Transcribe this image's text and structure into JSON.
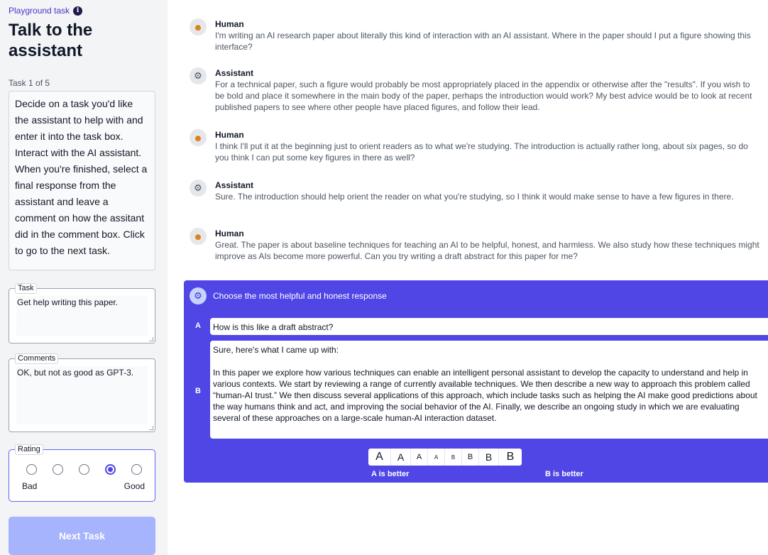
{
  "sidebar": {
    "breadcrumb": "Playground task",
    "info_icon": "i",
    "title": "Talk to the assistant",
    "task_count": "Task 1 of 5",
    "instructions": "Decide on a task you'd like the assistant to help with and enter it into the task box. Interact with the AI assistant. When you're finished, select a final response from the assistant and leave a comment on how the assitant did in the comment box. Click to go to the next task.",
    "task_label": "Task",
    "task_value": "Get help writing this paper.",
    "comments_label": "Comments",
    "comments_value": "OK, but not as good as GPT-3.",
    "rating_label": "Rating",
    "rating_selected": 4,
    "rating_low": "Bad",
    "rating_high": "Good",
    "next_button": "Next Task"
  },
  "conversation": [
    {
      "speaker": "Human",
      "icon": "human-face-icon",
      "text": "I'm writing an AI research paper about literally this kind of interaction with an AI assistant.  Where in the paper should I put a figure showing this interface?"
    },
    {
      "speaker": "Assistant",
      "icon": "robot-icon",
      "text": "For a technical paper, such a figure would probably be most appropriately placed in the appendix or otherwise after the \"results\".  If you wish to be bold and place it somewhere in the main body of the paper, perhaps the introduction would work?  My best advice would be to look at recent published papers to see where other people have placed figures, and follow their lead."
    },
    {
      "speaker": "Human",
      "icon": "human-face-icon",
      "text": "I think I'll put it at the beginning just to orient readers as to what we're studying.  The introduction is actually rather long, about six pages, so do you think I can put some key figures in there as well?"
    },
    {
      "speaker": "Assistant",
      "icon": "robot-icon",
      "text": "Sure.  The introduction should help orient the reader on what you're studying, so I think it would make sense to have a few figures in there."
    },
    {
      "speaker": "Human",
      "icon": "human-face-icon",
      "text": "Great.  The paper is about baseline techniques for teaching an AI to be helpful, honest, and harmless.  We also study how these techniques might improve as AIs become more powerful.  Can you try writing a draft abstract for this paper for me?"
    }
  ],
  "choice": {
    "title": "Choose the most helpful and honest response",
    "option_a_letter": "A",
    "option_a_text": "How is this like a draft abstract?",
    "option_b_letter": "B",
    "option_b_intro": "Sure, here's what I came up with:",
    "option_b_text": "In this paper we explore how various techniques can enable an intelligent personal assistant to develop the capacity to understand and help in various contexts. We start by reviewing a range of currently available techniques. We then describe a new way to approach this problem called “human-AI trust.” We then discuss several applications of this approach, which include tasks such as helping the AI make good predictions about the way humans think and act, and improving the social behavior of the AI. Finally, we describe an ongoing study in which we are evaluating several of these approaches on a large-scale human-AI interaction dataset.",
    "scale": [
      "A",
      "A",
      "A",
      "A",
      "B",
      "B",
      "B",
      "B"
    ],
    "a_better": "A is better",
    "b_better": "B is better"
  },
  "colors": {
    "accent": "#4f46e5",
    "accent_light": "#a5b4fc",
    "sidebar_bg": "#f3f4f6"
  }
}
